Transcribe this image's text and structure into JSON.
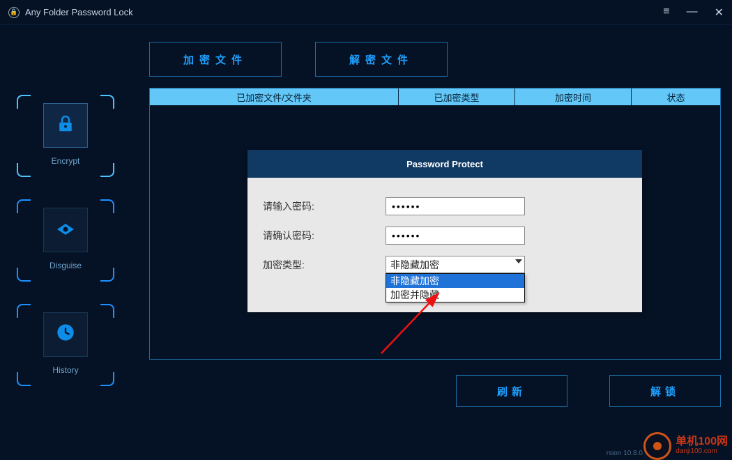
{
  "titlebar": {
    "app_title": "Any Folder Password Lock"
  },
  "sidebar": {
    "items": [
      {
        "label": "Encrypt",
        "icon": "🔒"
      },
      {
        "label": "Disguise",
        "icon": "◉"
      },
      {
        "label": "History",
        "icon": "🕘"
      }
    ]
  },
  "top_tabs": {
    "encrypt_label": "加密文件",
    "decrypt_label": "解密文件"
  },
  "table": {
    "col1": "已加密文件/文件夹",
    "col2": "已加密类型",
    "col3": "加密时间",
    "col4": "状态"
  },
  "modal": {
    "title": "Password Protect",
    "password_label": "请输入密码:",
    "confirm_label": "请确认密码:",
    "type_label": "加密类型:",
    "password_value": "••••••",
    "confirm_value": "••••••",
    "type_selected": "非隐藏加密",
    "options": [
      "非隐藏加密",
      "加密并隐藏"
    ]
  },
  "bottom": {
    "refresh_label": "刷新",
    "unlock_label": "解锁"
  },
  "footer": {
    "version": "rsion 10.8.0",
    "watermark_top": "单机100网",
    "watermark_bottom": "danji100.com"
  }
}
